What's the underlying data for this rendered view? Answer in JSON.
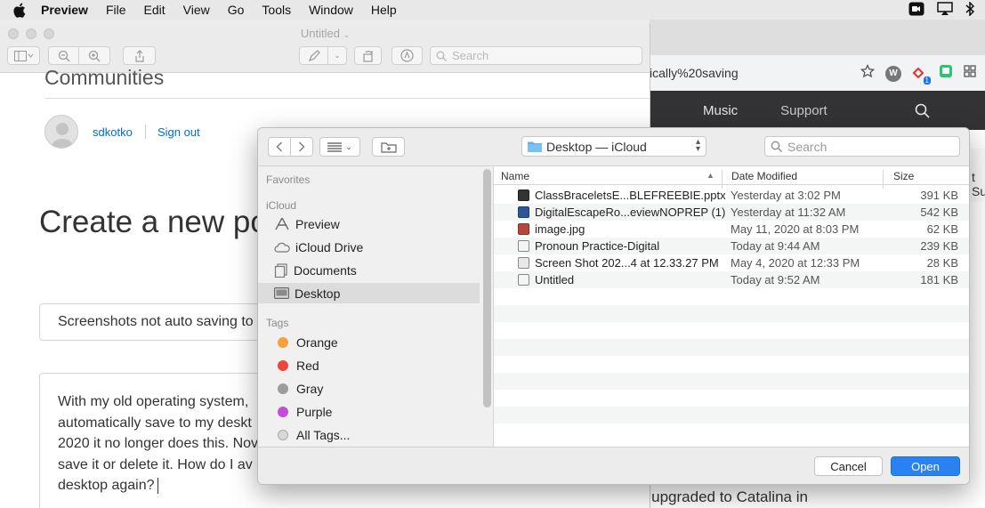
{
  "menubar": {
    "app": "Preview",
    "items": [
      "File",
      "Edit",
      "View",
      "Go",
      "Tools",
      "Window",
      "Help"
    ]
  },
  "browser": {
    "url": "ically%20saving",
    "nav": {
      "music": "Music",
      "support": "Support"
    },
    "badge": "1",
    "extension_label": "W",
    "partial_text": "t Su",
    "bottom_text": "ave upgraded to Catalina in"
  },
  "preview": {
    "title": "Untitled",
    "search_placeholder": "Search"
  },
  "page": {
    "section": "Communities",
    "username": "sdkotko",
    "sign_out": "Sign out",
    "heading": "Create a new po",
    "subject_value": "Screenshots not auto saving to",
    "body_lines": [
      "With my old operating system,",
      "automatically save to my deskt",
      "2020 it no longer does this. Nov",
      "save it or delete it. How do I av",
      "desktop again?"
    ]
  },
  "dialog": {
    "location": "Desktop — iCloud",
    "search_placeholder": "Search",
    "sidebar": {
      "favorites_label": "Favorites",
      "icloud_label": "iCloud",
      "icloud_items": [
        {
          "label": "Preview",
          "icon": "preview-app-icon"
        },
        {
          "label": "iCloud Drive",
          "icon": "cloud-icon"
        },
        {
          "label": "Documents",
          "icon": "documents-icon"
        },
        {
          "label": "Desktop",
          "icon": "desktop-icon",
          "selected": true
        }
      ],
      "tags_label": "Tags",
      "tags": [
        {
          "label": "Orange",
          "color": "#f5a03c"
        },
        {
          "label": "Red",
          "color": "#f0443a"
        },
        {
          "label": "Gray",
          "color": "#9c9c9c"
        },
        {
          "label": "Purple",
          "color": "#c44fd6"
        },
        {
          "label": "All Tags...",
          "color": "#d8d8d8"
        }
      ]
    },
    "columns": {
      "name": "Name",
      "date": "Date Modified",
      "size": "Size"
    },
    "files": [
      {
        "name": "ClassBraceletsE...BLEFREEBIE.pptx",
        "date": "Yesterday at 3:02 PM",
        "size": "391 KB",
        "icon": "pptx-file-icon"
      },
      {
        "name": "DigitalEscapeRo...eviewNOPREP (1)",
        "date": "Yesterday at 11:32 AM",
        "size": "542 KB",
        "icon": "word-file-icon"
      },
      {
        "name": "image.jpg",
        "date": "May 11, 2020 at 8:03 PM",
        "size": "62 KB",
        "icon": "image-file-icon"
      },
      {
        "name": "Pronoun Practice-Digital",
        "date": "Today at 9:44 AM",
        "size": "239 KB",
        "icon": "document-file-icon"
      },
      {
        "name": "Screen Shot 202...4 at 12.33.27 PM",
        "date": "May 4, 2020 at 12:33 PM",
        "size": "28 KB",
        "icon": "screenshot-file-icon"
      },
      {
        "name": "Untitled",
        "date": "Today at 9:52 AM",
        "size": "181 KB",
        "icon": "document-file-icon"
      }
    ],
    "cancel_label": "Cancel",
    "open_label": "Open"
  }
}
